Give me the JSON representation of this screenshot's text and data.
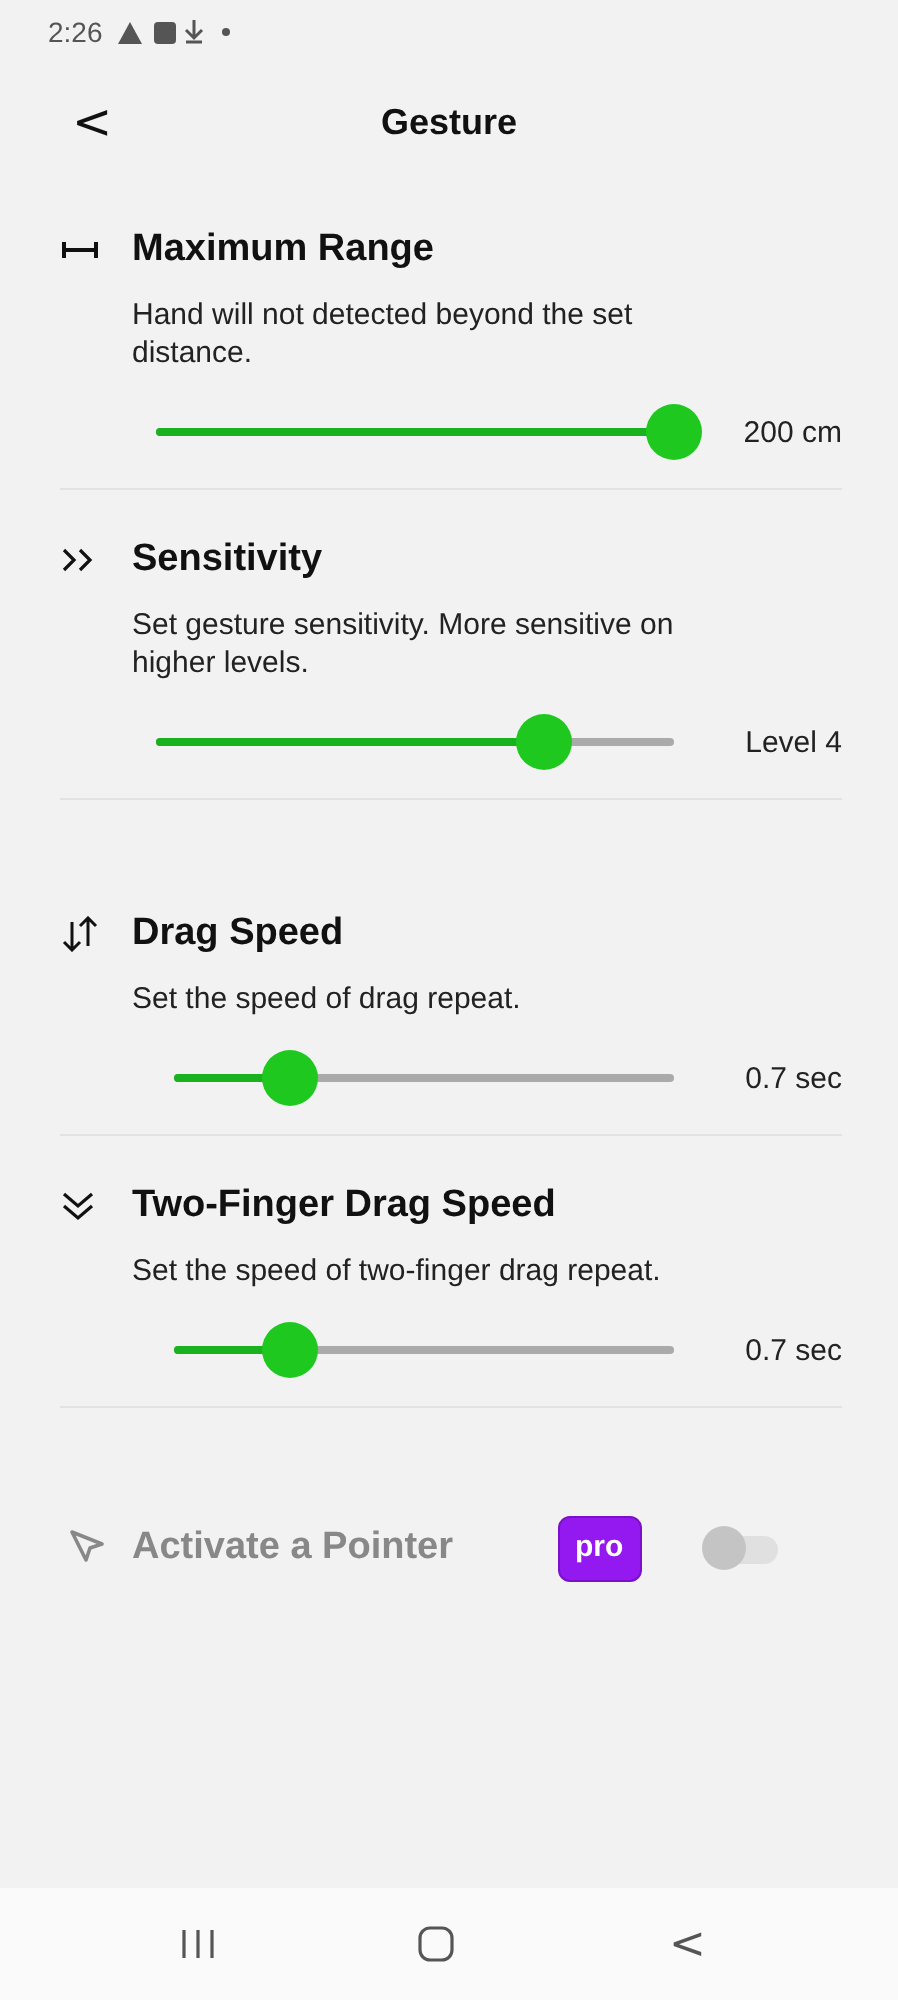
{
  "status_bar": {
    "time": "2:26"
  },
  "header": {
    "back": "<",
    "title": "Gesture"
  },
  "sections": [
    {
      "title": "Maximum Range",
      "description": "Hand will not detected beyond the set distance.",
      "level": 1.0,
      "reading": "200 cm"
    },
    {
      "title": "Sensitivity",
      "description": "Set gesture sensitivity. More sensitive on higher levels.",
      "level": 0.75,
      "reading": "Level 4"
    },
    {
      "title": "Drag Speed",
      "description": "Set the speed of drag repeat.",
      "level": 0.23,
      "reading": "0.7 sec"
    },
    {
      "title": "Two-Finger Drag Speed",
      "description": "Set the speed of two-finger drag repeat.",
      "level": 0.23,
      "reading": "0.7 sec"
    }
  ],
  "pointer": {
    "title": "Activate a Pointer",
    "disabled": true,
    "badge": "pro",
    "on": false
  },
  "nav_bar": {
    "back": "<"
  }
}
